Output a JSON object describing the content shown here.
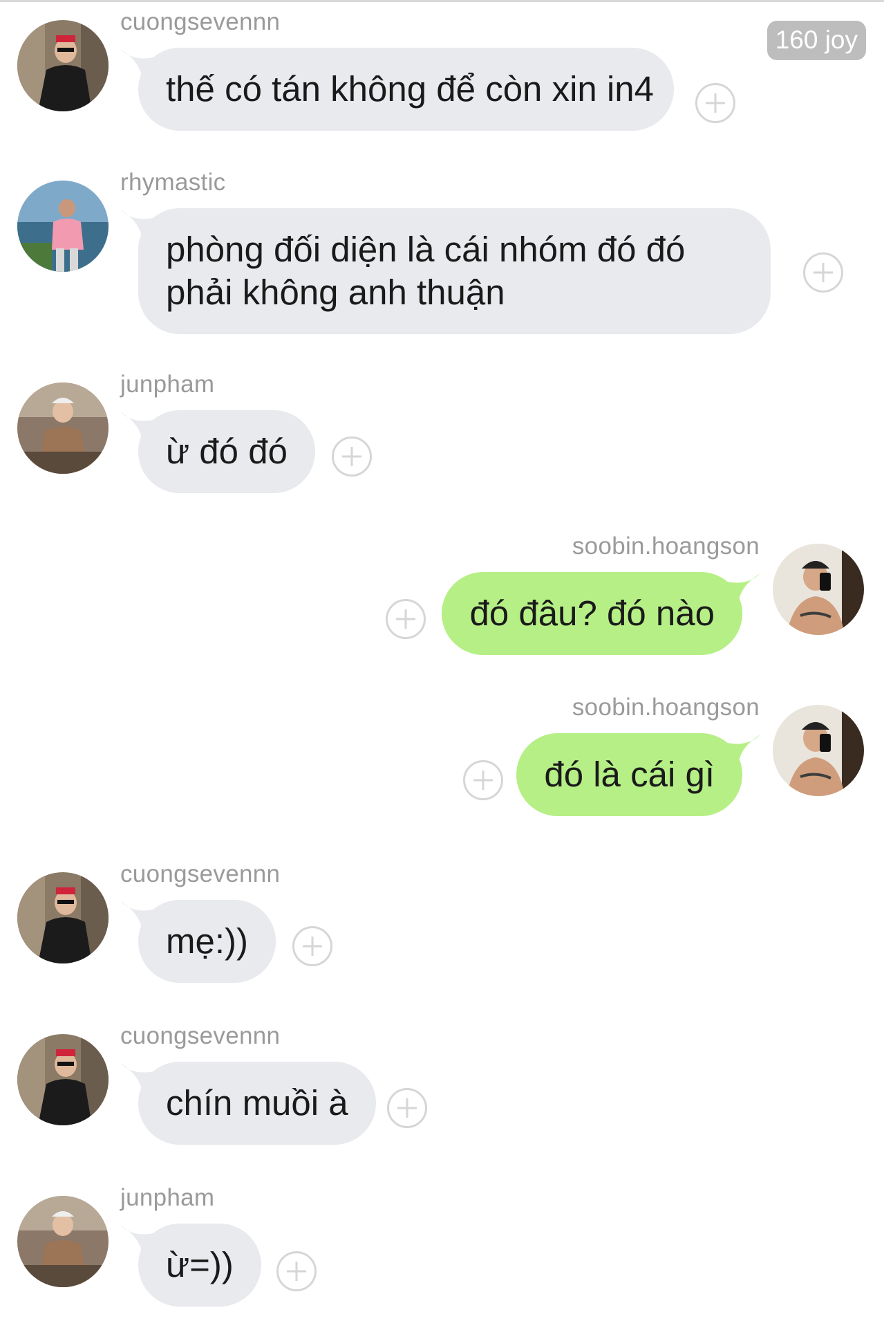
{
  "header": {
    "badge": "160 joy"
  },
  "messages": [
    {
      "user": "cuongsevennn",
      "text": "thế có tán không để còn xin in4",
      "side": "in"
    },
    {
      "user": "rhymastic",
      "text": "phòng đối diện là cái nhóm đó đó phải không anh thuận",
      "side": "in"
    },
    {
      "user": "junpham",
      "text": "ừ đó đó",
      "side": "in"
    },
    {
      "user": "soobin.hoangson",
      "text": "đó đâu? đó nào",
      "side": "out"
    },
    {
      "user": "soobin.hoangson",
      "text": "đó là cái gì",
      "side": "out"
    },
    {
      "user": "cuongsevennn",
      "text": "mẹ:))",
      "side": "in"
    },
    {
      "user": "cuongsevennn",
      "text": "chín muồi à",
      "side": "in"
    },
    {
      "user": "junpham",
      "text": "ừ=))",
      "side": "in"
    }
  ],
  "colors": {
    "incoming_bubble": "#e8eaed",
    "outgoing_bubble": "#b6ef86",
    "username": "#9a9a9a",
    "badge_bg": "#bdbdbd"
  },
  "icons": {
    "add_reaction": "plus-circle-icon"
  }
}
